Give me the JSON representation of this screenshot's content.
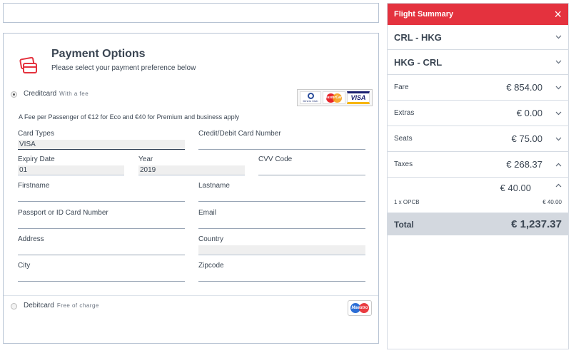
{
  "payment": {
    "title": "Payment Options",
    "subtitle": "Please select your payment preference below",
    "credit_option": {
      "label": "Creditcard",
      "note": "With a fee",
      "selected": true
    },
    "debit_option": {
      "label": "Debitcard",
      "note": "Free of charge",
      "selected": false
    },
    "card_logos": [
      "Diners Club",
      "MasterCard",
      "VISA"
    ],
    "debit_logo": "Maestro",
    "fee_note": "A Fee per Passenger of €12 for Eco and €40 for Premium and business apply",
    "fields": {
      "card_types": {
        "label": "Card Types",
        "value": "VISA"
      },
      "card_number": {
        "label": "Credit/Debit Card Number",
        "value": ""
      },
      "expiry_date": {
        "label": "Expiry Date",
        "value": "01"
      },
      "year": {
        "label": "Year",
        "value": "2019"
      },
      "cvv": {
        "label": "CVV Code",
        "value": ""
      },
      "firstname": {
        "label": "Firstname",
        "value": ""
      },
      "lastname": {
        "label": "Lastname",
        "value": ""
      },
      "passport": {
        "label": "Passport or ID Card Number",
        "value": ""
      },
      "email": {
        "label": "Email",
        "value": ""
      },
      "address": {
        "label": "Address",
        "value": ""
      },
      "country": {
        "label": "Country",
        "value": ""
      },
      "city": {
        "label": "City",
        "value": ""
      },
      "zipcode": {
        "label": "Zipcode",
        "value": ""
      }
    }
  },
  "summary": {
    "title": "Flight Summary",
    "close_icon": "×",
    "routes": [
      "CRL - HKG",
      "HKG - CRL"
    ],
    "lines": {
      "fare": {
        "label": "Fare",
        "value": "€ 854.00"
      },
      "extras": {
        "label": "Extras",
        "value": "€ 0.00"
      },
      "seats": {
        "label": "Seats",
        "value": "€ 75.00"
      },
      "taxes": {
        "label": "Taxes",
        "value": "€ 268.37"
      }
    },
    "tax_detail": {
      "value": "€ 40.00",
      "name": "1 x OPCB",
      "amount": "€ 40.00"
    },
    "total": {
      "label": "Total",
      "value": "€ 1,237.37"
    }
  },
  "icons": {
    "chevron_down": "chevron-down-icon",
    "chevron_up": "chevron-up-icon",
    "payment": "credit-card-icon"
  },
  "colors": {
    "accent": "#e4323e",
    "text": "#3b4653",
    "total_bg": "#d3d8df"
  }
}
